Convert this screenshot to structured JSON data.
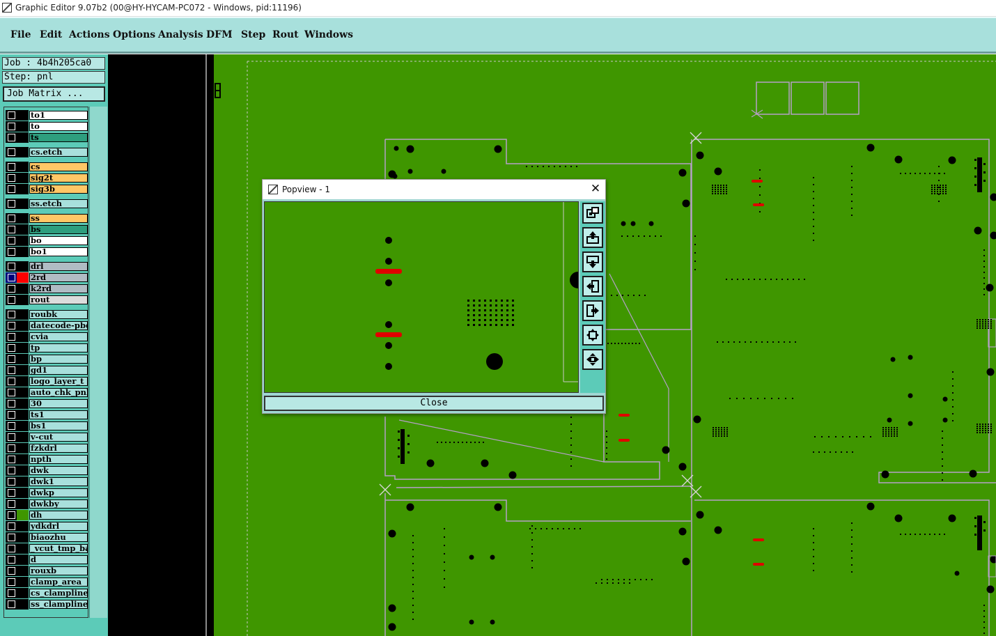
{
  "window": {
    "title": "Graphic Editor 9.07b2 (00@HY-HYCAM-PC072 - Windows, pid:11196)"
  },
  "menu": [
    "File",
    "Edit",
    "Actions",
    "Options",
    "Analysis",
    "DFM",
    "Step",
    "Rout",
    "Windows"
  ],
  "job": {
    "job_text": "Job : 4b4h205ca0",
    "step_text": "Step: pnl",
    "matrix_button": "Job Matrix ..."
  },
  "layers": [
    {
      "name": "to1",
      "color": "#ffffff",
      "swatch": "#000000"
    },
    {
      "name": "to",
      "color": "#ffffff",
      "swatch": "#000000"
    },
    {
      "name": "ts",
      "color": "#2e9e7e",
      "swatch": "#000000"
    },
    {
      "name": "cs.etch",
      "color": "#a8e0dc",
      "swatch": "#000000"
    },
    {
      "name": "cs",
      "color": "#ffc766",
      "swatch": "#000000"
    },
    {
      "name": "sig2t",
      "color": "#ffc766",
      "swatch": "#000000"
    },
    {
      "name": "sig3b",
      "color": "#ffc766",
      "swatch": "#000000"
    },
    {
      "name": "ss.etch",
      "color": "#a8e0dc",
      "swatch": "#000000"
    },
    {
      "name": "ss",
      "color": "#ffc766",
      "swatch": "#000000"
    },
    {
      "name": "bs",
      "color": "#2e9e7e",
      "swatch": "#000000"
    },
    {
      "name": "bo",
      "color": "#ffffff",
      "swatch": "#000000"
    },
    {
      "name": "bo1",
      "color": "#ffffff",
      "swatch": "#000000"
    },
    {
      "name": "drl",
      "color": "#b0bcc4",
      "swatch": "#000000"
    },
    {
      "name": "2rd",
      "color": "#b0bcc4",
      "swatch": "#ff0000",
      "selected": true
    },
    {
      "name": "k2rd",
      "color": "#b0bcc4",
      "swatch": "#000000"
    },
    {
      "name": "rout",
      "color": "#dcdcdc",
      "swatch": "#000000"
    },
    {
      "name": "roubk",
      "color": "#a8e0dc",
      "swatch": "#000000"
    },
    {
      "name": "datecode-pbe",
      "color": "#a8e0dc",
      "swatch": "#000000"
    },
    {
      "name": "cvia",
      "color": "#a8e0dc",
      "swatch": "#000000"
    },
    {
      "name": "tp",
      "color": "#a8e0dc",
      "swatch": "#000000"
    },
    {
      "name": "bp",
      "color": "#a8e0dc",
      "swatch": "#000000"
    },
    {
      "name": "gd1",
      "color": "#a8e0dc",
      "swatch": "#000000"
    },
    {
      "name": "logo_layer_t",
      "color": "#a8e0dc",
      "swatch": "#000000"
    },
    {
      "name": "auto_chk_pnl",
      "color": "#a8e0dc",
      "swatch": "#000000"
    },
    {
      "name": "30",
      "color": "#a8e0dc",
      "swatch": "#000000"
    },
    {
      "name": "ts1",
      "color": "#a8e0dc",
      "swatch": "#000000"
    },
    {
      "name": "bs1",
      "color": "#a8e0dc",
      "swatch": "#000000"
    },
    {
      "name": "v-cut",
      "color": "#a8e0dc",
      "swatch": "#000000"
    },
    {
      "name": "fzkdrl",
      "color": "#a8e0dc",
      "swatch": "#000000"
    },
    {
      "name": "npth",
      "color": "#a8e0dc",
      "swatch": "#000000"
    },
    {
      "name": "dwk",
      "color": "#a8e0dc",
      "swatch": "#000000"
    },
    {
      "name": "dwk1",
      "color": "#a8e0dc",
      "swatch": "#000000"
    },
    {
      "name": "dwkp",
      "color": "#a8e0dc",
      "swatch": "#000000"
    },
    {
      "name": "dwkby",
      "color": "#a8e0dc",
      "swatch": "#000000"
    },
    {
      "name": "dh",
      "color": "#a8e0dc",
      "swatch": "#3f9600"
    },
    {
      "name": "ydkdrl",
      "color": "#a8e0dc",
      "swatch": "#000000"
    },
    {
      "name": "biaozhu",
      "color": "#a8e0dc",
      "swatch": "#000000"
    },
    {
      "name": "_vcut_tmp_ba",
      "color": "#a8e0dc",
      "swatch": "#000000"
    },
    {
      "name": "d",
      "color": "#a8e0dc",
      "swatch": "#000000"
    },
    {
      "name": "rouxb",
      "color": "#a8e0dc",
      "swatch": "#000000"
    },
    {
      "name": "clamp_area",
      "color": "#a8e0dc",
      "swatch": "#000000"
    },
    {
      "name": "cs_clampline",
      "color": "#a8e0dc",
      "swatch": "#000000"
    },
    {
      "name": "ss_clampline",
      "color": "#a8e0dc",
      "swatch": "#000000"
    }
  ],
  "popview": {
    "title": "Popview - 1",
    "close_label": "Close",
    "close_glyph": "✕",
    "tools": [
      "popview-icon",
      "zoom-top-icon",
      "zoom-bottom-icon",
      "zoom-left-icon",
      "zoom-right-icon",
      "fit-all-icon",
      "zoom-center-icon"
    ]
  },
  "colors": {
    "board_green": "#3f9600",
    "panel_teal": "#5ccbb8",
    "menu_bg": "#a8e0dc",
    "drill_red": "#e00000"
  }
}
